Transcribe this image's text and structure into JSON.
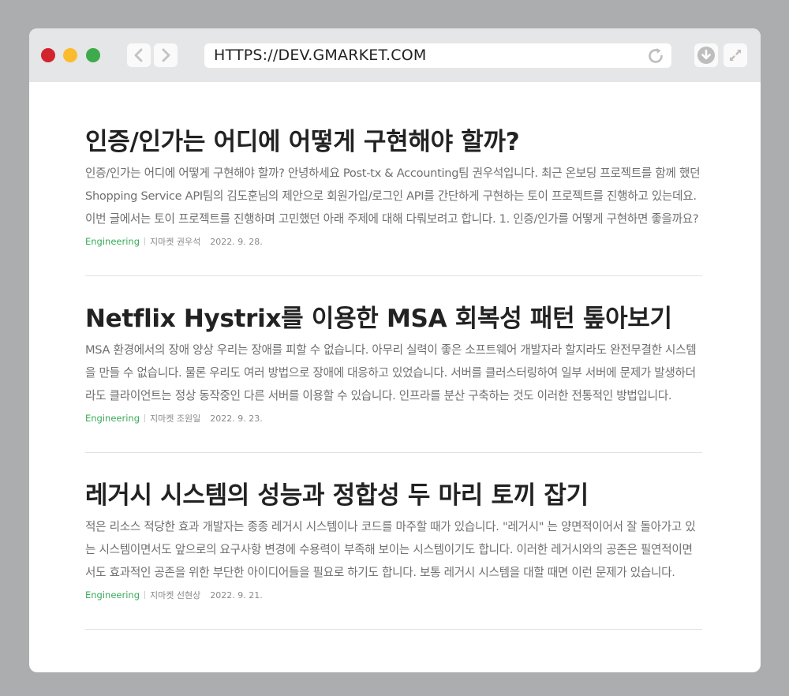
{
  "browser": {
    "url": "HTTPS://DEV.GMARKET.COM",
    "traffic_lights": {
      "close": "#d2232e",
      "minimize": "#fcbb2c",
      "maximize": "#3daa4b"
    },
    "icons": {
      "back": "chevron-left-icon",
      "forward": "chevron-right-icon",
      "reload": "reload-icon",
      "download": "download-icon",
      "fullscreen": "fullscreen-icon"
    }
  },
  "posts": [
    {
      "title": "인증/인가는 어디에 어떻게 구현해야 할까?",
      "excerpt": "인증/인가는 어디에 어떻게 구현해야 할까? 안녕하세요 Post-tx & Accounting팀 권우석입니다. 최근 온보딩 프로젝트를 함께 했던 Shopping Service API팀의 김도훈님의 제안으로 회원가입/로그인 API를 간단하게 구현하는 토이 프로젝트를 진행하고 있는데요. 이번 글에서는 토이 프로젝트를 진행하며 고민했던 아래 주제에 대해 다뤄보려고 합니다. 1. 인증/인가를 어떻게 구현하면 좋을까요?",
      "category": "Engineering",
      "author": "지마켓 권우석",
      "date": "2022. 9. 28."
    },
    {
      "title": "Netflix Hystrix를 이용한 MSA 회복성 패턴 톺아보기",
      "excerpt": "MSA 환경에서의 장애 양상 우리는 장애를 피할 수 없습니다. 아무리 실력이 좋은 소프트웨어 개발자라 할지라도 완전무결한 시스템을 만들 수 없습니다. 물론 우리도 여러 방법으로 장애에 대응하고 있었습니다. 서버를 클러스터링하여 일부 서버에 문제가 발생하더라도 클라이언트는 정상 동작중인 다른 서버를 이용할 수 있습니다. 인프라를 분산 구축하는 것도 이러한 전통적인 방법입니다.",
      "category": "Engineering",
      "author": "지마켓 조원일",
      "date": "2022. 9. 23."
    },
    {
      "title": "레거시 시스템의 성능과 정합성 두 마리 토끼 잡기",
      "excerpt": "적은 리소스 적당한 효과 개발자는 종종 레거시 시스템이나 코드를 마주할 때가 있습니다. \"레거시\" 는 양면적이어서 잘 돌아가고 있는 시스템이면서도 앞으로의 요구사항 변경에 수용력이 부족해 보이는 시스템이기도 합니다. 이러한 레거시와의 공존은 필연적이면서도 효과적인 공존을 위한 부단한 아이디어들을 필요로 하기도 합니다. 보통 레거시 시스템을 대할 때면 이런 문제가 있습니다.",
      "category": "Engineering",
      "author": "지마켓 선현상",
      "date": "2022. 9. 21."
    }
  ]
}
